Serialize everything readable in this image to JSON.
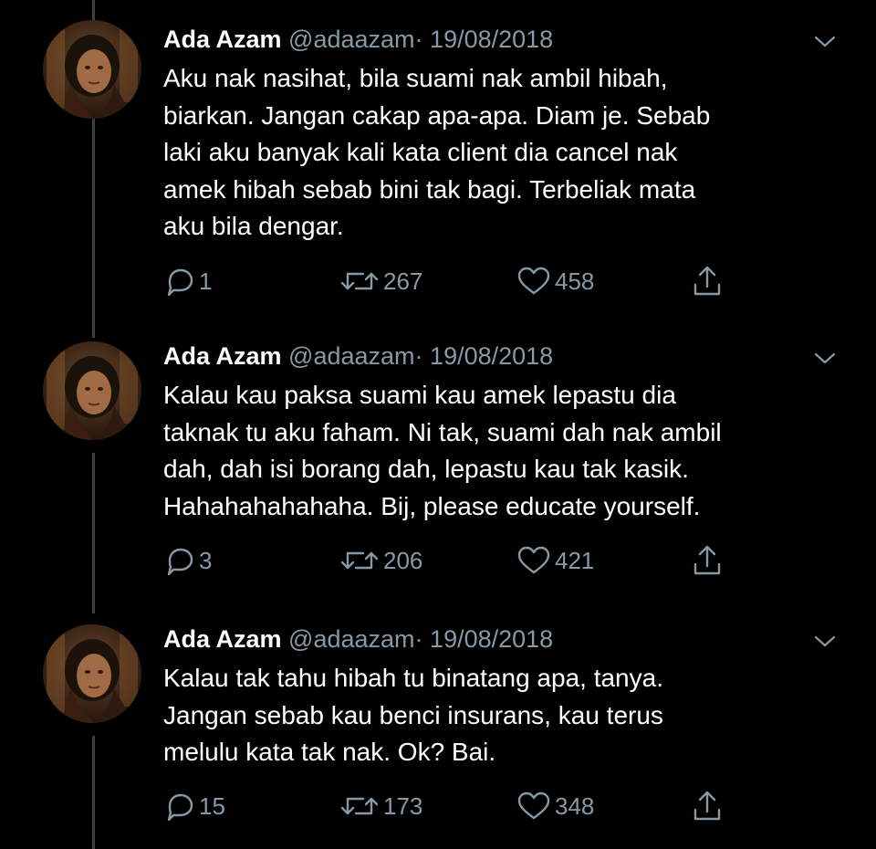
{
  "colors": {
    "background": "#000000",
    "text": "#ffffff",
    "muted": "#8899a6",
    "thread_line": "#3a3f44"
  },
  "tweets": [
    {
      "name": "Ada Azam",
      "handle": "@adaazam",
      "separator": "·",
      "date": "19/08/2018",
      "text": "Aku nak nasihat, bila suami nak ambil hibah,\nbiarkan. Jangan cakap apa-apa. Diam je. Sebab\nlaki aku banyak kali kata client dia cancel nak\namek hibah sebab bini tak bagi. Terbeliak mata\naku bila dengar.",
      "replies": "1",
      "retweets": "267",
      "likes": "458",
      "icons": [
        "reply-icon",
        "retweet-icon",
        "like-icon",
        "share-icon",
        "chevron-down-icon"
      ]
    },
    {
      "name": "Ada Azam",
      "handle": "@adaazam",
      "separator": "·",
      "date": "19/08/2018",
      "text": "Kalau kau paksa suami kau amek lepastu dia\ntaknak tu aku faham. Ni tak, suami dah nak ambil\ndah, dah isi borang dah, lepastu kau tak kasik.\nHahahahahahaha. Bij, please educate yourself.",
      "replies": "3",
      "retweets": "206",
      "likes": "421",
      "icons": [
        "reply-icon",
        "retweet-icon",
        "like-icon",
        "share-icon",
        "chevron-down-icon"
      ]
    },
    {
      "name": "Ada Azam",
      "handle": "@adaazam",
      "separator": "·",
      "date": "19/08/2018",
      "text": "Kalau tak tahu hibah tu binatang apa, tanya.\nJangan sebab kau benci insurans, kau terus\nmelulu kata tak nak. Ok? Bai.",
      "replies": "15",
      "retweets": "173",
      "likes": "348",
      "icons": [
        "reply-icon",
        "retweet-icon",
        "like-icon",
        "share-icon",
        "chevron-down-icon"
      ]
    }
  ]
}
